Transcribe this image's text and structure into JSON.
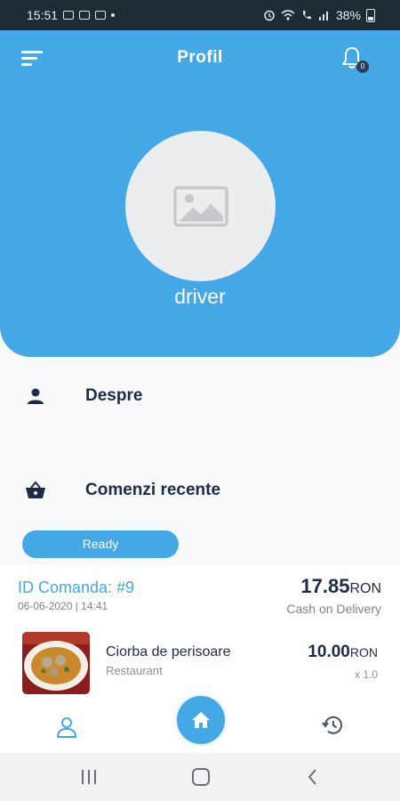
{
  "status_bar": {
    "time": "15:51",
    "battery": "38%"
  },
  "header": {
    "title": "Profil",
    "notification_count": "0",
    "username": "driver"
  },
  "menu": [
    {
      "label": "Despre",
      "icon": "person-icon"
    },
    {
      "label": "Comenzi recente",
      "icon": "basket-icon"
    }
  ],
  "order": {
    "status": "Ready",
    "id_label": "ID Comanda: #9",
    "date": "06-06-2020 | 14:41",
    "total": "17.85",
    "currency": "RON",
    "payment": "Cash on Delivery",
    "item": {
      "name": "Ciorba de perisoare",
      "category": "Restaurant",
      "price": "10.00",
      "currency": "RON",
      "qty": "x 1.0"
    }
  },
  "bottom_nav": {
    "tabs": [
      "profile-icon",
      "home-icon",
      "history-icon"
    ],
    "active": "profile-icon"
  },
  "colors": {
    "primary": "#45a8e6",
    "dark_text": "#1e2b48",
    "muted_text": "#7d838c"
  }
}
